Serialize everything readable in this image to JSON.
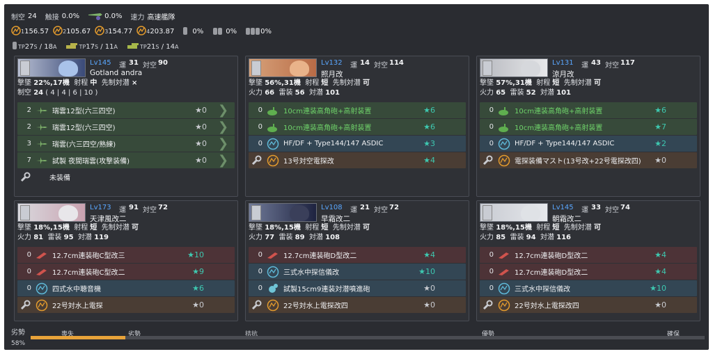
{
  "fleet": {
    "air_label": "制空",
    "air_value": "24",
    "tp_label": "触接",
    "tp_value": "0.0%",
    "rad_value": "0.0%",
    "speed_label": "速力",
    "speed_value": "高速艦隊",
    "los": [
      "156.57",
      "105.67",
      "154.77",
      "203.87"
    ],
    "los_sub": [
      "1",
      "2",
      "3",
      "4"
    ],
    "drum": [
      "0%",
      "0%",
      "0%"
    ],
    "tp1": "27",
    "tp1s": "S",
    "tp1b": "/ 18",
    "tp1bs": "A",
    "tp2": "17",
    "tp2s": "S",
    "tp2b": "/ 11",
    "tp2bs": "A",
    "tp3": "21",
    "tp3s": "S",
    "tp3b": "/ 14",
    "tp3bs": "A",
    "tp_small": "TP"
  },
  "labels": {
    "luck": "運",
    "aa": "対空",
    "shoot": "撃墜",
    "range": "射程",
    "oasw": "先制対潜",
    "fire": "火力",
    "torp": "雷装",
    "asw": "対潜",
    "air": "制空"
  },
  "ships": [
    {
      "lv": "Lv145",
      "luck": "31",
      "aa": "90",
      "name": "Gotland andra",
      "shoot": "22%,17機",
      "range": "中",
      "oasw": "×",
      "air": "24",
      "slots": "( 4 | 4 | 6 | 10 )",
      "equip": [
        {
          "n": "2",
          "name": "瑞雲12型(六三四空)",
          "star": "★0",
          "c": "g",
          "icon": "plane",
          "arr": true
        },
        {
          "n": "2",
          "name": "瑞雲12型(六三四空)",
          "star": "★0",
          "c": "g",
          "icon": "plane",
          "arr": true
        },
        {
          "n": "3",
          "name": "瑞雲(六三四空/熟練)",
          "star": "★0",
          "c": "g",
          "icon": "plane",
          "arr": true
        },
        {
          "n": "7",
          "name": "試製 夜間瑞雲(攻撃装備)",
          "star": "★0",
          "c": "g",
          "icon": "plane",
          "arr": true
        },
        {
          "n": "",
          "name": "未装備",
          "star": "",
          "c": "n",
          "icon": "wrench"
        }
      ]
    },
    {
      "lv": "Lv132",
      "luck": "14",
      "aa": "114",
      "name": "照月改",
      "shoot": "56%,31機",
      "range": "短",
      "oasw": "可",
      "fire": "66",
      "torp": "56",
      "asw": "101",
      "equip": [
        {
          "n": "0",
          "name": "10cm連装高角砲+高射装置",
          "star": "★6",
          "c": "g",
          "icon": "gun",
          "grn": true
        },
        {
          "n": "0",
          "name": "10cm連装高角砲+高射装置",
          "star": "★6",
          "c": "g",
          "icon": "gun",
          "grn": true
        },
        {
          "n": "0",
          "name": "HF/DF + Type144/147 ASDIC",
          "star": "★3",
          "c": "b",
          "icon": "sonar"
        },
        {
          "n": "",
          "name": "13号対空電探改",
          "star": "★4",
          "c": "o",
          "icon": "radar"
        }
      ]
    },
    {
      "lv": "Lv131",
      "luck": "43",
      "aa": "117",
      "name": "涼月改",
      "shoot": "57%,31機",
      "range": "短",
      "oasw": "可",
      "fire": "65",
      "torp": "52",
      "asw": "101",
      "equip": [
        {
          "n": "0",
          "name": "10cm連装高角砲+高射装置",
          "star": "★6",
          "c": "g",
          "icon": "gun",
          "grn": true
        },
        {
          "n": "0",
          "name": "10cm連装高角砲+高射装置",
          "star": "★7",
          "c": "g",
          "icon": "gun",
          "grn": true
        },
        {
          "n": "0",
          "name": "HF/DF + Type144/147 ASDIC",
          "star": "★2",
          "c": "b",
          "icon": "sonar"
        },
        {
          "n": "",
          "name": "電探装備マスト(13号改+22号電探改四)",
          "star": "★0",
          "c": "o",
          "icon": "radar"
        }
      ]
    },
    {
      "lv": "Lv173",
      "luck": "91",
      "aa": "72",
      "name": "天津風改二",
      "shoot": "18%,15機",
      "range": "短",
      "oasw": "可",
      "fire": "81",
      "torp": "95",
      "asw": "119",
      "equip": [
        {
          "n": "0",
          "name": "12.7cm連装砲C型改三",
          "star": "★10",
          "c": "r",
          "icon": "main"
        },
        {
          "n": "0",
          "name": "12.7cm連装砲C型改二",
          "star": "★9",
          "c": "r",
          "icon": "main"
        },
        {
          "n": "0",
          "name": "四式水中聴音機",
          "star": "★6",
          "c": "b",
          "icon": "sonar"
        },
        {
          "n": "",
          "name": "22号対水上電探",
          "star": "★0",
          "c": "o",
          "icon": "radar"
        }
      ]
    },
    {
      "lv": "Lv108",
      "luck": "21",
      "aa": "72",
      "name": "早霜改二",
      "shoot": "18%,15機",
      "range": "短",
      "oasw": "可",
      "fire": "77",
      "torp": "89",
      "asw": "108",
      "equip": [
        {
          "n": "0",
          "name": "12.7cm連装砲D型改二",
          "star": "★4",
          "c": "r",
          "icon": "main"
        },
        {
          "n": "0",
          "name": "三式水中探信儀改",
          "star": "★10",
          "c": "b",
          "icon": "sonar"
        },
        {
          "n": "0",
          "name": "試製15cm9連装対潜噴進砲",
          "star": "★0",
          "c": "b",
          "icon": "rocket"
        },
        {
          "n": "",
          "name": "22号対水上電探改四",
          "star": "★0",
          "c": "o",
          "icon": "radar"
        }
      ]
    },
    {
      "lv": "Lv145",
      "luck": "33",
      "aa": "74",
      "name": "朝霜改二",
      "shoot": "18%,15機",
      "range": "短",
      "oasw": "可",
      "fire": "85",
      "torp": "94",
      "asw": "116",
      "equip": [
        {
          "n": "0",
          "name": "12.7cm連装砲D型改二",
          "star": "★4",
          "c": "r",
          "icon": "main"
        },
        {
          "n": "0",
          "name": "12.7cm連装砲D型改二",
          "star": "★4",
          "c": "r",
          "icon": "main"
        },
        {
          "n": "0",
          "name": "三式水中探信儀改",
          "star": "★10",
          "c": "b",
          "icon": "sonar"
        },
        {
          "n": "",
          "name": "22号対水上電探改四",
          "star": "★0",
          "c": "o",
          "icon": "radar"
        }
      ]
    }
  ],
  "air_state": {
    "label": "劣勢",
    "pct": "58%",
    "fill": 0.14,
    "marks": [
      "喪失",
      "劣勢",
      "拮抗",
      "優勢",
      "確保"
    ]
  },
  "colors": {
    "bg": "#2a2c31",
    "card": "#2f3136",
    "aa_eq": "#374a3a",
    "sonar_eq": "#334654",
    "main_eq": "#4d3337",
    "radar_eq": "#4a3d34",
    "lv": "#5aa7ff",
    "bar": "#e8a33a"
  }
}
